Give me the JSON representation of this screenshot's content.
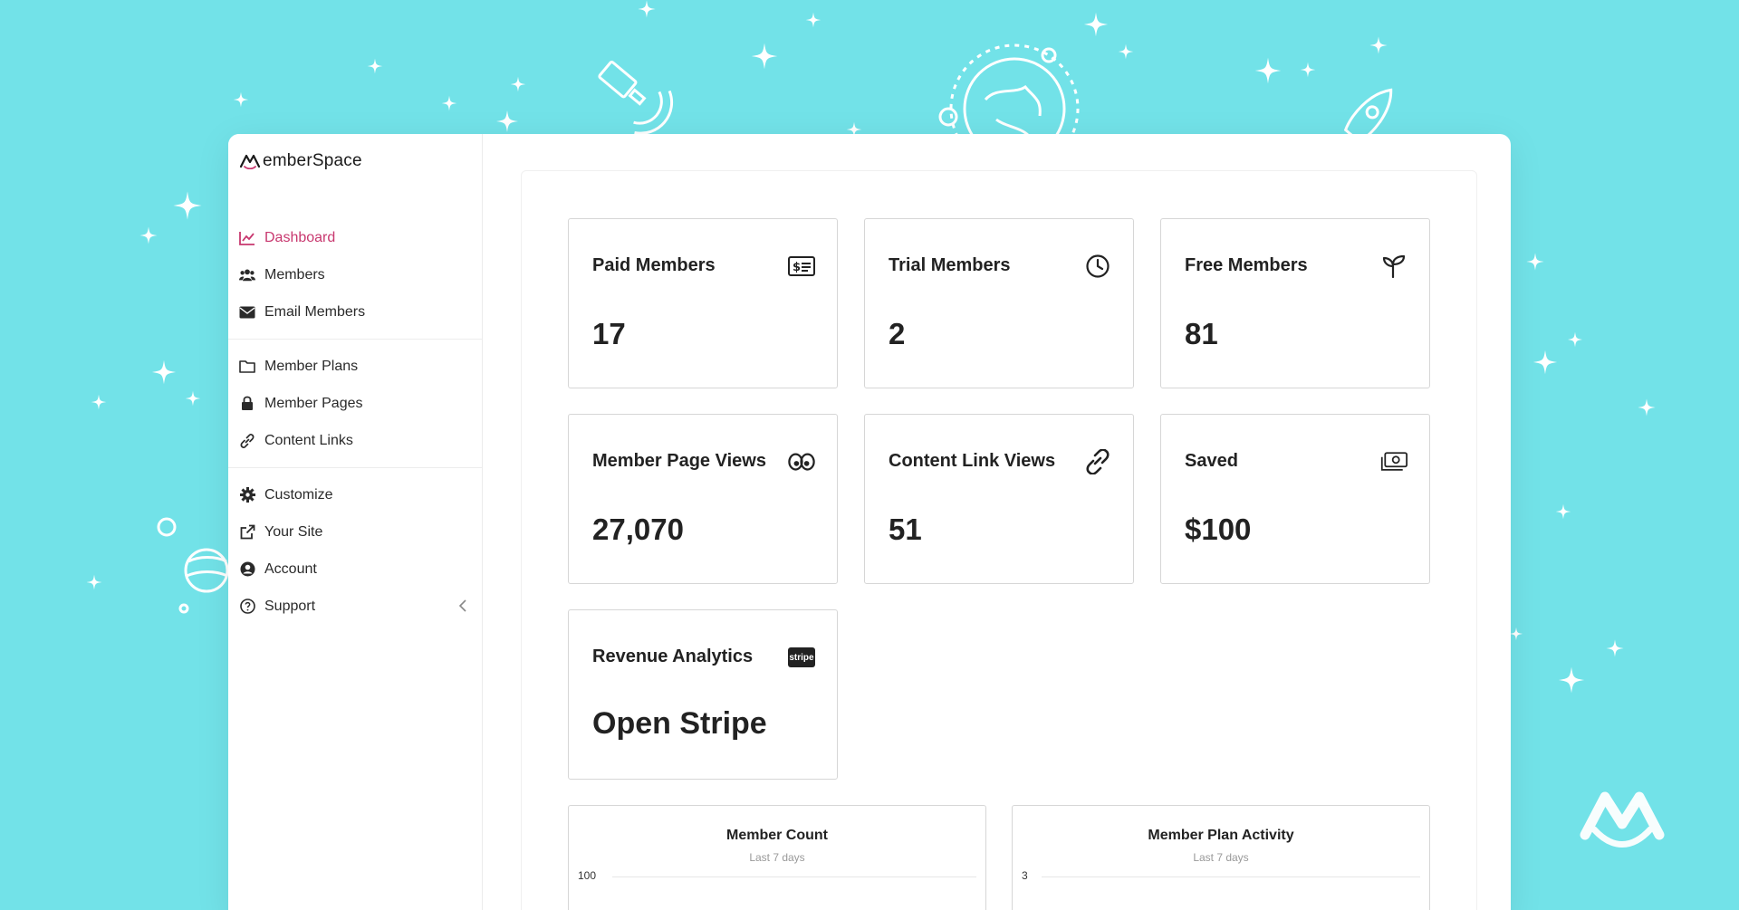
{
  "brand": {
    "name": "emberSpace",
    "accent": "#c8386f"
  },
  "sidebar": {
    "groups": [
      [
        {
          "label": "Dashboard",
          "icon": "chart-line-icon",
          "active": true
        },
        {
          "label": "Members",
          "icon": "users-icon"
        },
        {
          "label": "Email Members",
          "icon": "envelope-icon"
        }
      ],
      [
        {
          "label": "Member Plans",
          "icon": "folder-icon"
        },
        {
          "label": "Member Pages",
          "icon": "lock-icon"
        },
        {
          "label": "Content Links",
          "icon": "link-icon"
        }
      ],
      [
        {
          "label": "Customize",
          "icon": "gear-icon"
        },
        {
          "label": "Your Site",
          "icon": "external-link-icon"
        },
        {
          "label": "Account",
          "icon": "user-circle-icon"
        },
        {
          "label": "Support",
          "icon": "question-circle-icon"
        }
      ]
    ]
  },
  "stats": {
    "paid": {
      "title": "Paid Members",
      "value": "17",
      "icon": "dollar-bill-icon"
    },
    "trial": {
      "title": "Trial Members",
      "value": "2",
      "icon": "clock-icon"
    },
    "free": {
      "title": "Free Members",
      "value": "81",
      "icon": "sprout-icon"
    },
    "page_views": {
      "title": "Member Page Views",
      "value": "27,070",
      "icon": "eyes-icon"
    },
    "link_views": {
      "title": "Content Link Views",
      "value": "51",
      "icon": "link-icon"
    },
    "saved": {
      "title": "Saved",
      "value": "$100",
      "icon": "money-icon"
    },
    "revenue": {
      "title": "Revenue Analytics",
      "value": "Open Stripe",
      "icon": "stripe-icon",
      "icon_text": "stripe"
    }
  },
  "charts": {
    "member_count": {
      "title": "Member Count",
      "subtitle": "Last 7 days",
      "tick": "100"
    },
    "plan_activity": {
      "title": "Member Plan Activity",
      "subtitle": "Last 7 days",
      "tick": "3"
    }
  },
  "colors": {
    "background": "#72e2e8",
    "active_nav": "#c8386f"
  }
}
